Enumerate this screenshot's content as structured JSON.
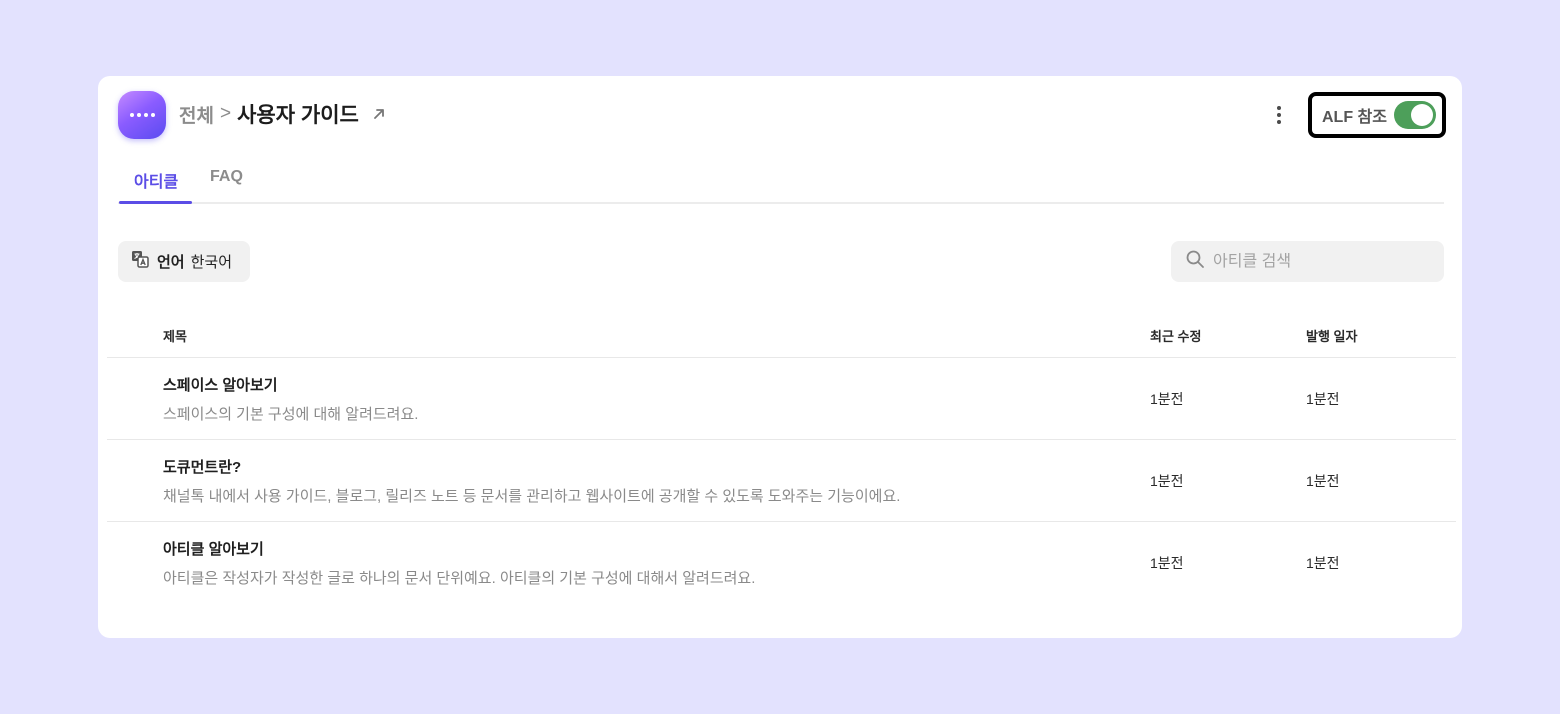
{
  "header": {
    "breadcrumb_root": "전체",
    "breadcrumb_separator": ">",
    "title": "사용자 가이드",
    "alf_label": "ALF 참조",
    "alf_enabled": true
  },
  "tabs": [
    {
      "label": "아티클",
      "active": true
    },
    {
      "label": "FAQ",
      "active": false
    }
  ],
  "toolbar": {
    "language_label": "언어",
    "language_value": "한국어",
    "search_placeholder": "아티클 검색"
  },
  "table": {
    "columns": {
      "title": "제목",
      "modified": "최근 수정",
      "published": "발행 일자"
    },
    "rows": [
      {
        "title": "스페이스 알아보기",
        "description": "스페이스의 기본 구성에 대해 알려드려요.",
        "modified": "1분전",
        "published": "1분전"
      },
      {
        "title": "도큐먼트란?",
        "description": "채널톡 내에서 사용 가이드, 블로그, 릴리즈 노트 등 문서를 관리하고 웹사이트에 공개할 수 있도록 도와주는 기능이에요.",
        "modified": "1분전",
        "published": "1분전"
      },
      {
        "title": "아티클 알아보기",
        "description": "아티클은 작성자가 작성한 글로 하나의 문서 단위예요. 아티클의 기본 구성에 대해서 알려드려요.",
        "modified": "1분전",
        "published": "1분전"
      }
    ]
  },
  "colors": {
    "background": "#e3e2fe",
    "accent": "#5b4de6",
    "toggle_on": "#4d9f5a"
  }
}
